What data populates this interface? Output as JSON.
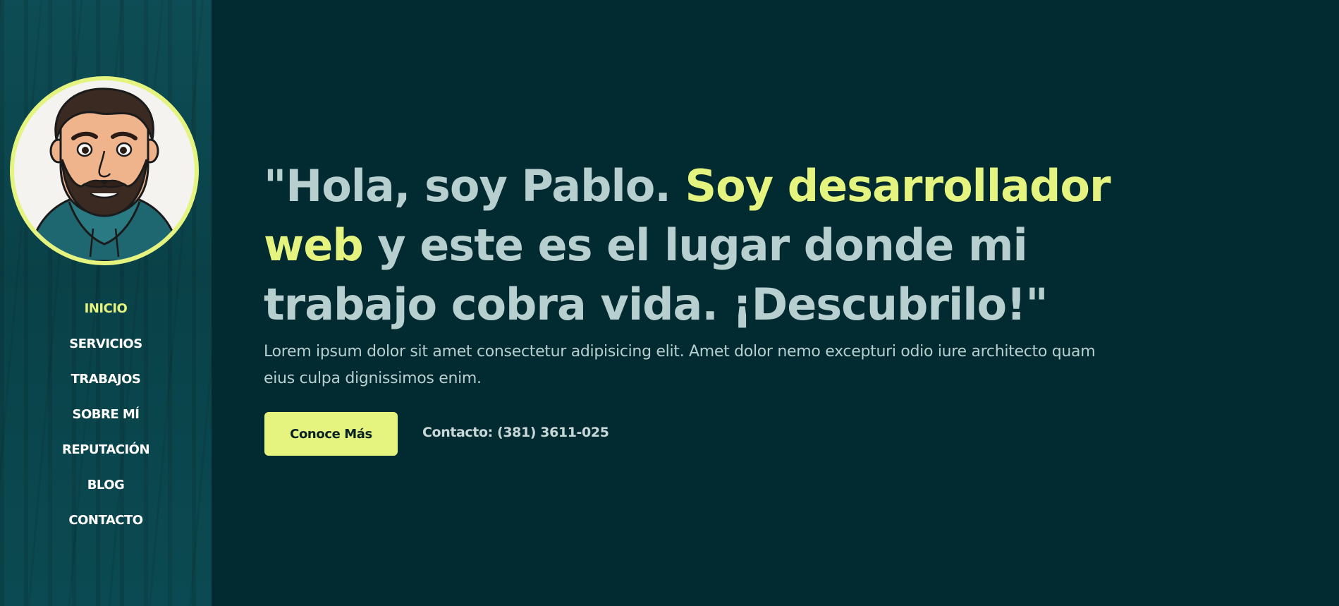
{
  "colors": {
    "background": "#022a31",
    "sidebar": "#0b4a52",
    "accent": "#e4f47f",
    "heading_text": "#b7cfcf",
    "nav_text": "#ffffff"
  },
  "sidebar": {
    "avatar_icon": "developer-portrait-icon",
    "nav_items": [
      {
        "label": "INICIO",
        "active": true
      },
      {
        "label": "SERVICIOS",
        "active": false
      },
      {
        "label": "TRABAJOS",
        "active": false
      },
      {
        "label": "SOBRE MÍ",
        "active": false
      },
      {
        "label": "REPUTACIÓN",
        "active": false
      },
      {
        "label": "BLOG",
        "active": false
      },
      {
        "label": "CONTACTO",
        "active": false
      }
    ]
  },
  "hero": {
    "title_part1": "\"Hola, soy Pablo. ",
    "title_highlight": "Soy desarrollador web",
    "title_part2": " y este es el lugar donde mi trabajo cobra vida. ¡Descubrilo!\"",
    "description": "Lorem ipsum dolor sit amet consectetur adipisicing elit. Amet dolor nemo excepturi odio iure architecto quam eius culpa dignissimos enim.",
    "cta_label": "Conoce Más",
    "contact": "Contacto: (381) 3611-025"
  }
}
